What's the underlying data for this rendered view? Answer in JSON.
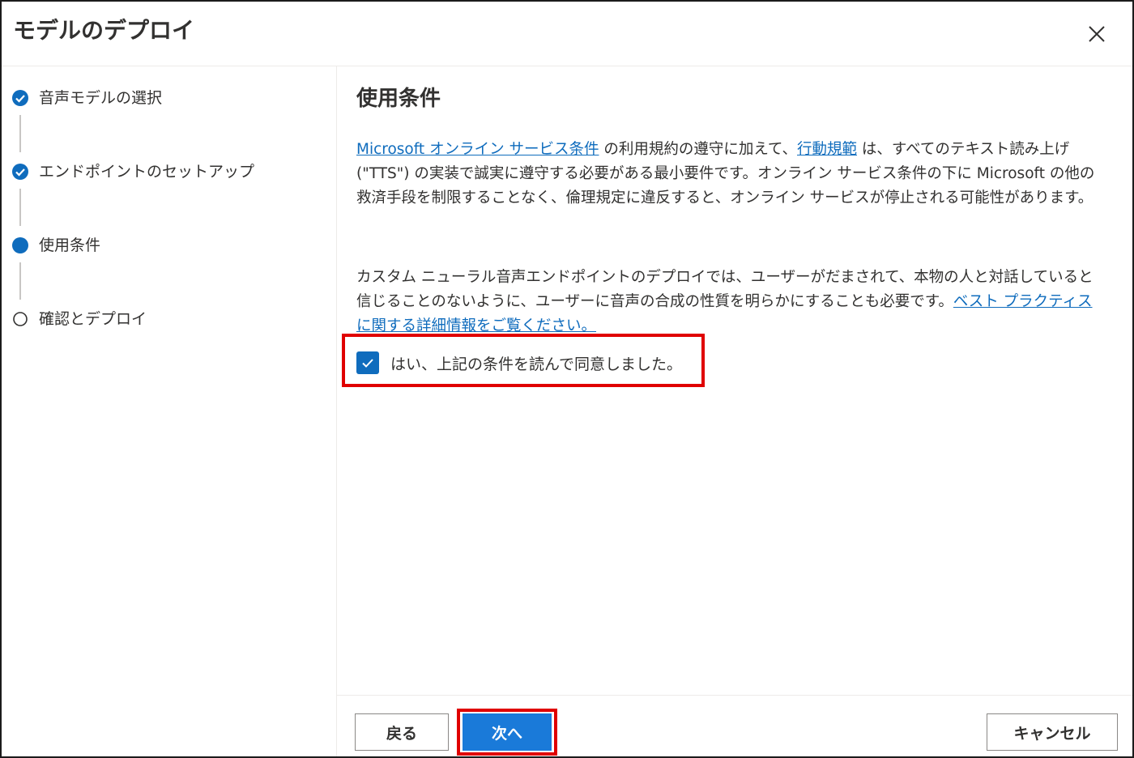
{
  "dialog": {
    "title": "モデルのデプロイ",
    "close_icon": "close-icon"
  },
  "steps": [
    {
      "label": "音声モデルの選択",
      "state": "completed",
      "icon": "check-circle-icon"
    },
    {
      "label": "エンドポイントのセットアップ",
      "state": "completed",
      "icon": "check-circle-icon"
    },
    {
      "label": "使用条件",
      "state": "current",
      "icon": "filled-circle-icon"
    },
    {
      "label": "確認とデプロイ",
      "state": "pending",
      "icon": "empty-circle-icon"
    }
  ],
  "terms": {
    "title": "使用条件",
    "para1_link1": "Microsoft オンライン サービス条件",
    "para1_text1": " の利用規約の遵守に加えて、",
    "para1_link2": "行動規範",
    "para1_text2": " は、すべてのテキスト読み上げ (\"TTS\") の実装で誠実に遵守する必要がある最小要件です。オンライン サービス条件の下に Microsoft の他の救済手段を制限することなく、倫理規定に違反すると、オンライン サービスが停止される可能性があります。",
    "para2_text": "カスタム ニューラル音声エンドポイントのデプロイでは、ユーザーがだまされて、本物の人と対話していると信じることのないように、ユーザーに音声の合成の性質を明らかにすることも必要です。",
    "para2_link": "ベスト プラクティスに関する詳細情報をご覧ください。",
    "agree_label": "はい、上記の条件を読んで同意しました。",
    "agree_checked": true
  },
  "footer": {
    "back_label": "戻る",
    "next_label": "次へ",
    "cancel_label": "キャンセル"
  },
  "colors": {
    "accent": "#0f6cbd",
    "primary_button": "#1a7ad9",
    "highlight": "#e00000"
  }
}
